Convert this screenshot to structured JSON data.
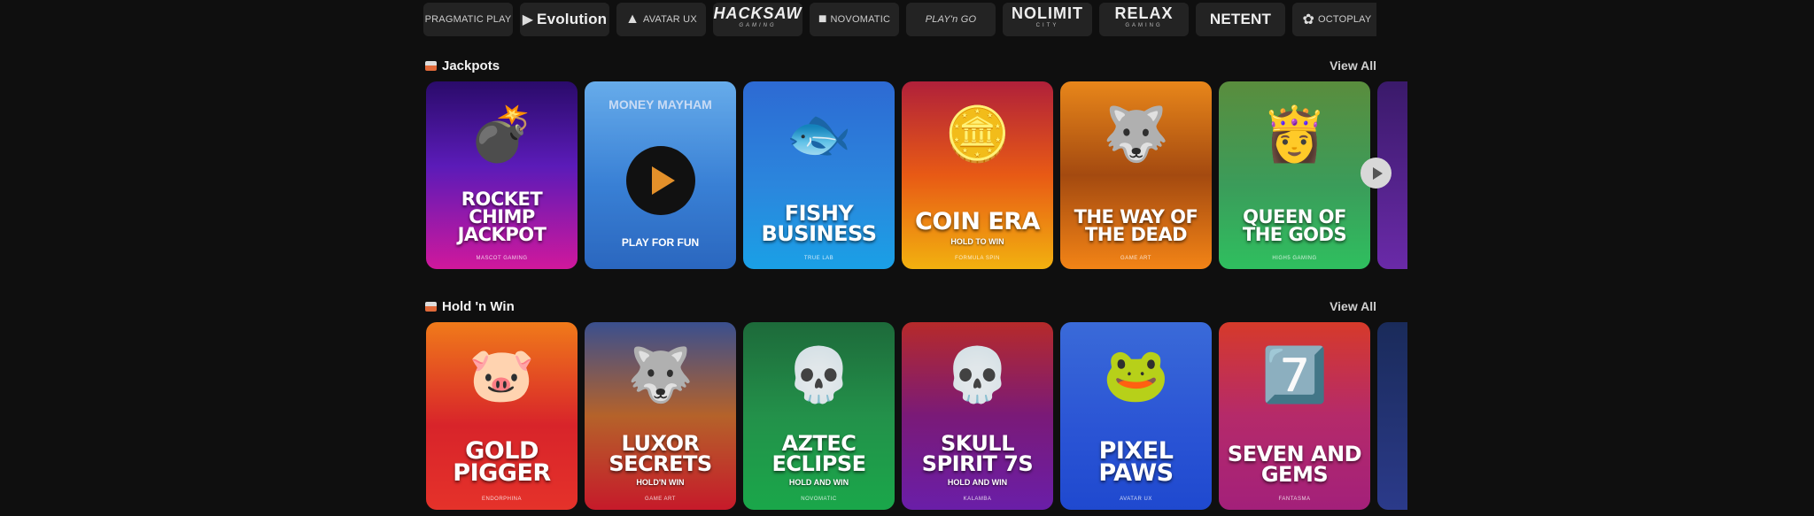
{
  "providers": [
    {
      "label": "PRAGMATIC PLAY",
      "style": "small",
      "glyph": ""
    },
    {
      "label": "Evolution",
      "style": "",
      "glyph": "▶"
    },
    {
      "label": "AVATAR UX",
      "style": "small",
      "glyph": "▲"
    },
    {
      "label": "HACKSAW",
      "sub": "GAMING",
      "style": "stacked italic",
      "glyph": ""
    },
    {
      "label": "NOVOMATIC",
      "style": "small",
      "glyph": "■"
    },
    {
      "label": "PLAY'n GO",
      "style": "italic small",
      "glyph": ""
    },
    {
      "label": "NOLIMIT",
      "sub": "CITY",
      "style": "stacked",
      "glyph": ""
    },
    {
      "label": "RELAX",
      "sub": "GAMING",
      "style": "stacked",
      "glyph": ""
    },
    {
      "label": "NETENT",
      "style": "",
      "glyph": ""
    },
    {
      "label": "OCTOPLAY",
      "style": "small",
      "glyph": "✿"
    }
  ],
  "sections": [
    {
      "title": "Jackpots",
      "icon": "jackpot-icon",
      "view_all": "View All",
      "games": [
        {
          "name": "ROCKET CHIMP JACKPOT",
          "sub": "",
          "provider": "MASCOT GAMING",
          "art": "💣",
          "bg": "linear-gradient(180deg,#2a0b6a 0%,#5b1bb8 45%,#d0189c 100%)"
        },
        {
          "name": "MONEY MAYHAM",
          "sub": "",
          "provider": "",
          "art": "",
          "bg": "linear-gradient(180deg,#7cc0f2 0%,#3f86d6 55%,#2c64b8 100%)",
          "hover": true,
          "hover_label": "PLAY FOR FUN"
        },
        {
          "name": "FISHY BUSINESS",
          "sub": "",
          "provider": "TRUE LAB",
          "art": "🐟",
          "bg": "linear-gradient(180deg,#2d6ad3 0%,#2b86dd 55%,#1aa0e6 100%)"
        },
        {
          "name": "COIN ERA",
          "sub": "HOLD TO WIN",
          "provider": "FORMULA SPIN",
          "art": "🪙",
          "bg": "linear-gradient(180deg,#b0203a 0%,#e85a15 50%,#f2b10f 100%)"
        },
        {
          "name": "THE WAY OF THE DEAD",
          "sub": "",
          "provider": "GAME ART",
          "art": "🐺",
          "bg": "linear-gradient(180deg,#e8861a 0%,#a44a10 50%,#f38416 100%)"
        },
        {
          "name": "QUEEN OF THE GODS",
          "sub": "",
          "provider": "HIGH5 GAMING",
          "art": "👸",
          "bg": "linear-gradient(180deg,#5a8d3d 0%,#3b9c5a 55%,#2fbf5f 100%)"
        },
        {
          "name": "",
          "sub": "",
          "provider": "",
          "art": "",
          "bg": "linear-gradient(180deg,#3a1a6a 0%,#6a2aa8 100%)"
        }
      ]
    },
    {
      "title": "Hold 'n Win",
      "icon": "hold-n-win-icon",
      "view_all": "View All",
      "games": [
        {
          "name": "GOLD PIGGER",
          "sub": "",
          "provider": "ENDORPHINA",
          "art": "🐷",
          "bg": "linear-gradient(180deg,#f07a1a 0%,#d8242a 55%,#e5322a 100%)"
        },
        {
          "name": "LUXOR SECRETS",
          "sub": "HOLD'N WIN",
          "provider": "GAME ART",
          "art": "🐺",
          "bg": "linear-gradient(180deg,#3a4f8e 0%,#b5622a 50%,#c61a2a 100%)"
        },
        {
          "name": "AZTEC ECLIPSE",
          "sub": "HOLD AND WIN",
          "provider": "NOVOMATIC",
          "art": "💀",
          "bg": "linear-gradient(180deg,#1d6a3a 0%,#23914a 50%,#1aa74a 100%)"
        },
        {
          "name": "SKULL SPIRIT 7S",
          "sub": "HOLD AND WIN",
          "provider": "KALAMBA",
          "art": "💀",
          "bg": "linear-gradient(180deg,#b62a2a 0%,#7a1a78 50%,#6a1ea8 100%)"
        },
        {
          "name": "PIXEL PAWS",
          "sub": "",
          "provider": "AVATAR UX",
          "art": "🐸",
          "bg": "linear-gradient(180deg,#3a6ad8 0%,#2b55d5 55%,#1f49cf 100%)"
        },
        {
          "name": "SEVEN AND GEMS",
          "sub": "",
          "provider": "FANTASMA",
          "art": "7️⃣",
          "bg": "linear-gradient(180deg,#d63a2a 0%,#b52a6a 50%,#a3207a 100%)"
        },
        {
          "name": "",
          "sub": "",
          "provider": "",
          "art": "",
          "bg": "linear-gradient(180deg,#1a2b5a 0%,#2b3a8a 100%)"
        }
      ]
    }
  ]
}
